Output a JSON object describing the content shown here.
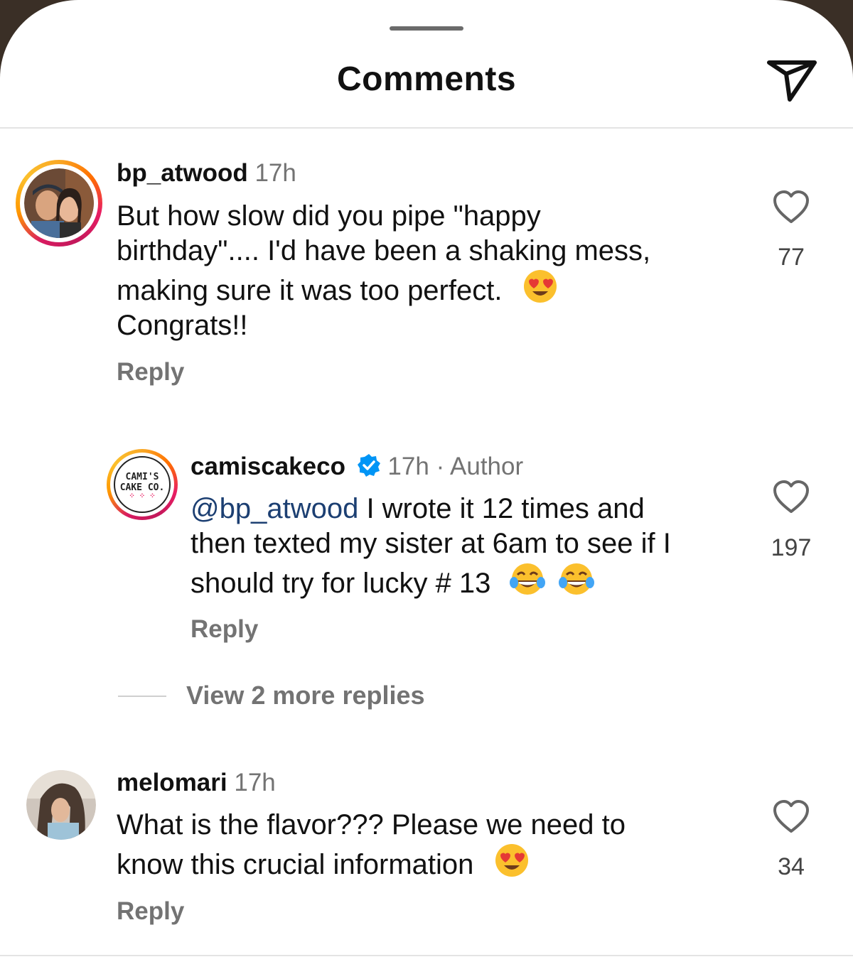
{
  "header": {
    "title": "Comments",
    "share_icon": "paper-plane-icon"
  },
  "comments": [
    {
      "username": "bp_atwood",
      "time": "17h",
      "lines": [
        "But how slow did you pipe \"happy",
        "birthday\".... I'd have been a shaking mess,",
        "making sure it was too perfect.",
        "Congrats!!"
      ],
      "emoji": "heart-eyes",
      "reply_label": "Reply",
      "likes": "77"
    },
    {
      "username": "camiscakeco",
      "time": "17h",
      "author_tag": "· Author",
      "verified": true,
      "avatar_logo": [
        "CAMI'S",
        "CAKE CO."
      ],
      "mention": "@bp_atwood",
      "lines": [
        " I wrote it 12 times and",
        "then texted my sister at 6am to see if I",
        "should try for lucky # 13"
      ],
      "emoji": "tears-of-joy",
      "reply_label": "Reply",
      "likes": "197"
    },
    {
      "username": "melomari",
      "time": "17h",
      "lines": [
        "What is the flavor??? Please we need to",
        "know this crucial information"
      ],
      "emoji": "heart-eyes",
      "reply_label": "Reply",
      "likes": "34"
    }
  ],
  "view_more": "View 2 more replies",
  "colors": {
    "ring": "#e91e63",
    "verified": "#0095f6",
    "mention": "#1c3f72",
    "muted": "#737373"
  }
}
